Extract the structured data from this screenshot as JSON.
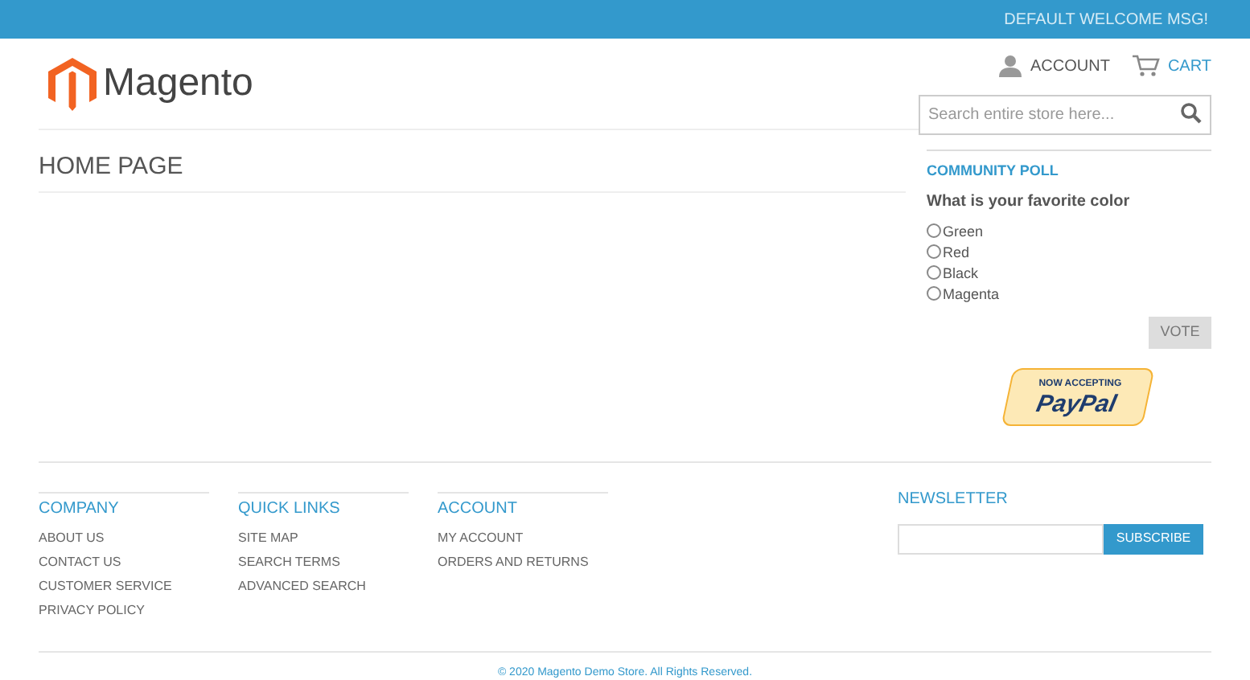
{
  "top_bar": {
    "welcome": "DEFAULT WELCOME MSG!"
  },
  "header": {
    "logo_text": "Magento",
    "account": "ACCOUNT",
    "cart": "CART",
    "search": {
      "placeholder": "Search entire store here..."
    }
  },
  "main": {
    "title": "HOME PAGE"
  },
  "poll": {
    "title": "COMMUNITY POLL",
    "question": "What is your favorite color",
    "options": [
      {
        "label": "Green",
        "selected": false
      },
      {
        "label": "Red",
        "selected": false
      },
      {
        "label": "Black",
        "selected": false
      },
      {
        "label": "Magenta",
        "selected": false
      }
    ],
    "button": "VOTE"
  },
  "paypal_badge": {
    "line_1": "NOW ACCEPTING",
    "line_2": "PayPal"
  },
  "footer": {
    "columns": [
      {
        "title": "COMPANY",
        "links": [
          "ABOUT US",
          "CONTACT US",
          "CUSTOMER SERVICE",
          "PRIVACY POLICY"
        ]
      },
      {
        "title": "QUICK LINKS",
        "links": [
          "SITE MAP",
          "SEARCH TERMS",
          "ADVANCED SEARCH"
        ]
      },
      {
        "title": "ACCOUNT",
        "links": [
          "MY ACCOUNT",
          "ORDERS AND RETURNS"
        ]
      }
    ],
    "newsletter": {
      "title": "NEWSLETTER",
      "button": "SUBSCRIBE"
    },
    "copyright": "© 2020 Magento Demo Store. All Rights Reserved."
  }
}
